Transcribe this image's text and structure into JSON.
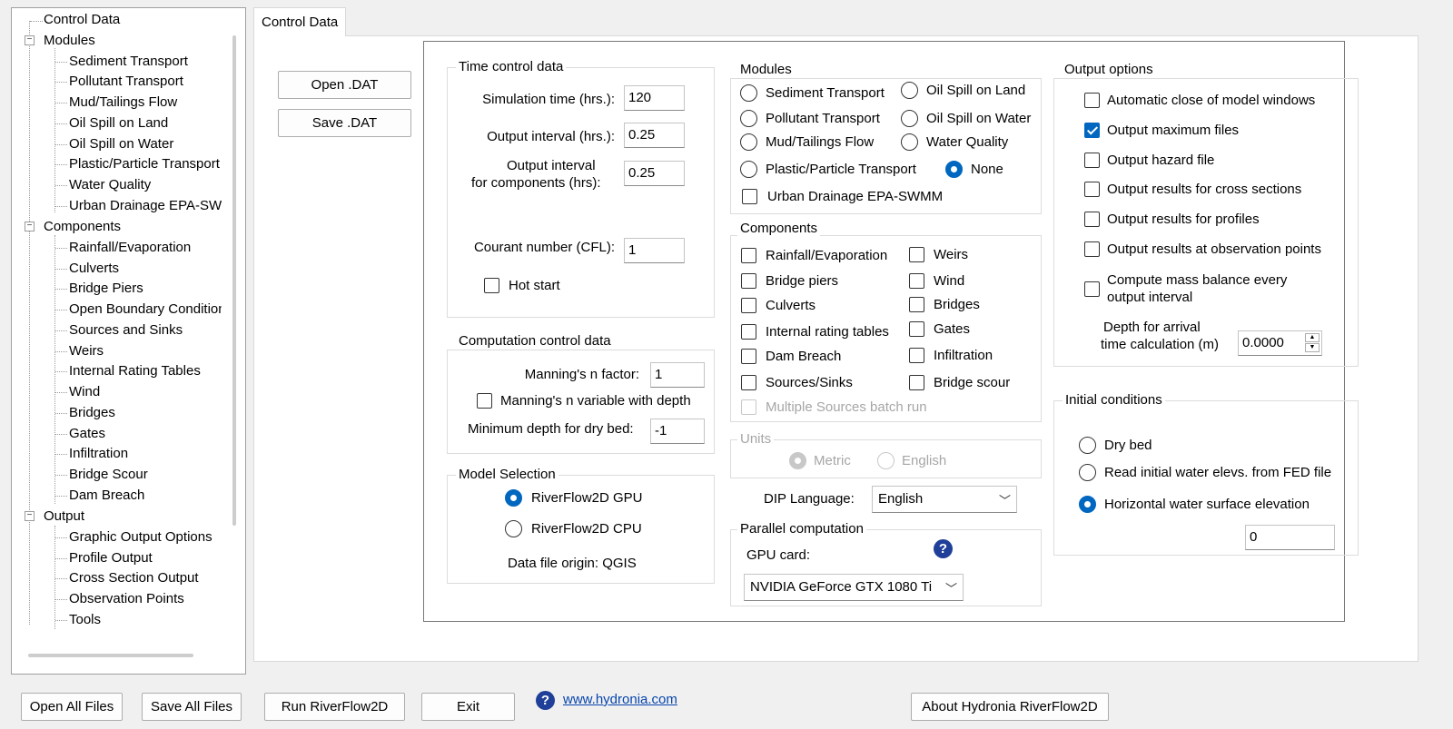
{
  "tree": {
    "root": "Control Data",
    "modules": {
      "label": "Modules",
      "items": [
        "Sediment Transport",
        "Pollutant Transport",
        "Mud/Tailings Flow",
        "Oil Spill on Land",
        "Oil Spill on Water",
        "Plastic/Particle Transport",
        "Water Quality",
        "Urban Drainage EPA-SWMM"
      ]
    },
    "components": {
      "label": "Components",
      "items": [
        "Rainfall/Evaporation",
        "Culverts",
        "Bridge Piers",
        "Open Boundary Conditions",
        "Sources and Sinks",
        "Weirs",
        "Internal Rating Tables",
        "Wind",
        "Bridges",
        "Gates",
        "Infiltration",
        "Bridge Scour",
        "Dam Breach"
      ]
    },
    "output": {
      "label": "Output",
      "items": [
        "Graphic Output Options",
        "Profile Output",
        "Cross Section Output",
        "Observation Points",
        "Tools"
      ]
    }
  },
  "tab": {
    "label": "Control Data"
  },
  "file_buttons": {
    "open_dat": "Open .DAT",
    "save_dat": "Save .DAT"
  },
  "time_control": {
    "title": "Time control data",
    "simulation_time_label": "Simulation time (hrs.):",
    "simulation_time": "120",
    "output_interval_label": "Output interval (hrs.):",
    "output_interval": "0.25",
    "output_interval_comp_label_1": "Output interval",
    "output_interval_comp_label_2": "for components (hrs):",
    "output_interval_comp": "0.25",
    "courant_label": "Courant number (CFL):",
    "courant": "1",
    "hot_start_label": "Hot start",
    "hot_start": false
  },
  "computation_control": {
    "title": "Computation control data",
    "manning_factor_label": "Manning's n factor:",
    "manning_factor": "1",
    "manning_variable_label": "Manning's n variable with depth",
    "min_depth_label": "Minimum depth for dry bed:",
    "min_depth": "-1"
  },
  "model_selection": {
    "title": "Model Selection",
    "gpu_label": "RiverFlow2D GPU",
    "cpu_label": "RiverFlow2D CPU",
    "selected": "gpu",
    "data_origin": "Data file origin: QGIS"
  },
  "modules": {
    "title": "Modules",
    "sediment": "Sediment Transport",
    "oil_land": "Oil Spill on Land",
    "pollutant": "Pollutant Transport",
    "oil_water": "Oil Spill on Water",
    "mud": "Mud/Tailings Flow",
    "water_quality": "Water Quality",
    "plastic": "Plastic/Particle Transport",
    "none": "None",
    "selected": "None",
    "urban": "Urban Drainage EPA-SWMM"
  },
  "components": {
    "title": "Components",
    "rainfall": "Rainfall/Evaporation",
    "weirs": "Weirs",
    "bridge_piers": "Bridge piers",
    "wind": "Wind",
    "culverts": "Culverts",
    "bridges": "Bridges",
    "internal_rating": "Internal rating tables",
    "gates": "Gates",
    "dam_breach": "Dam Breach",
    "infiltration": "Infiltration",
    "sources_sinks": "Sources/Sinks",
    "bridge_scour": "Bridge scour",
    "multiple_sources": "Multiple Sources batch run"
  },
  "units": {
    "title": "Units",
    "metric": "Metric",
    "english": "English",
    "selected": "Metric"
  },
  "dip_language": {
    "label": "DIP Language:",
    "value": "English"
  },
  "parallel": {
    "title": "Parallel computation",
    "gpu_card_label": "GPU card:",
    "gpu_card": "NVIDIA GeForce GTX 1080 Ti"
  },
  "output_options": {
    "title": "Output options",
    "auto_close": "Automatic close of model windows",
    "max_files": "Output maximum files",
    "hazard": "Output hazard file",
    "cross_sections": "Output results for cross sections",
    "profiles": "Output results for profiles",
    "observation_points": "Output results at observation points",
    "mass_balance_1": "Compute mass balance every",
    "mass_balance_2": "output interval",
    "depth_arrival_1": "Depth for arrival",
    "depth_arrival_2": "time calculation (m)",
    "depth_arrival_value": "0.0000"
  },
  "initial_conditions": {
    "title": "Initial conditions",
    "dry_bed": "Dry bed",
    "read_fed": "Read initial water elevs. from FED file",
    "horizontal": "Horizontal water surface elevation",
    "selected": "horizontal",
    "elevation": "0"
  },
  "bottom": {
    "open_all": "Open All Files",
    "save_all": "Save All Files",
    "run": "Run RiverFlow2D",
    "exit": "Exit",
    "website": "www.hydronia.com",
    "about": "About Hydronia RiverFlow2D"
  },
  "colors": {
    "accent": "#0067c0",
    "help_icon": "#1f3f99",
    "link": "#0645ad"
  }
}
